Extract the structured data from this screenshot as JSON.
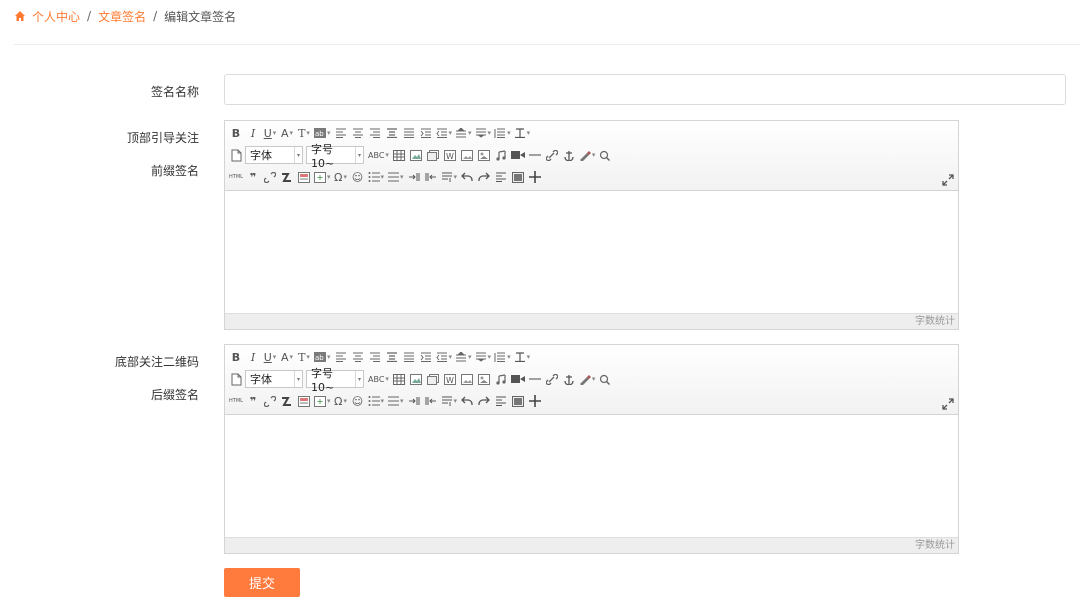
{
  "breadcrumb": {
    "items": [
      "个人中心",
      "文章签名"
    ],
    "separator": "/",
    "current": "编辑文章签名"
  },
  "form": {
    "name_label": "签名名称",
    "name_value": "",
    "top_label": "顶部引导关注",
    "prefix_label": "前缀签名",
    "bottom_label": "底部关注二维码",
    "suffix_label": "后缀签名",
    "submit_label": "提交"
  },
  "editor": {
    "font_family": "字体",
    "font_size": "字号 10~",
    "spellcheck": "ABC",
    "html": "HTML",
    "status": "字数统计"
  },
  "colors": {
    "accent": "#ff7a3d",
    "link": "#ff7a30"
  }
}
